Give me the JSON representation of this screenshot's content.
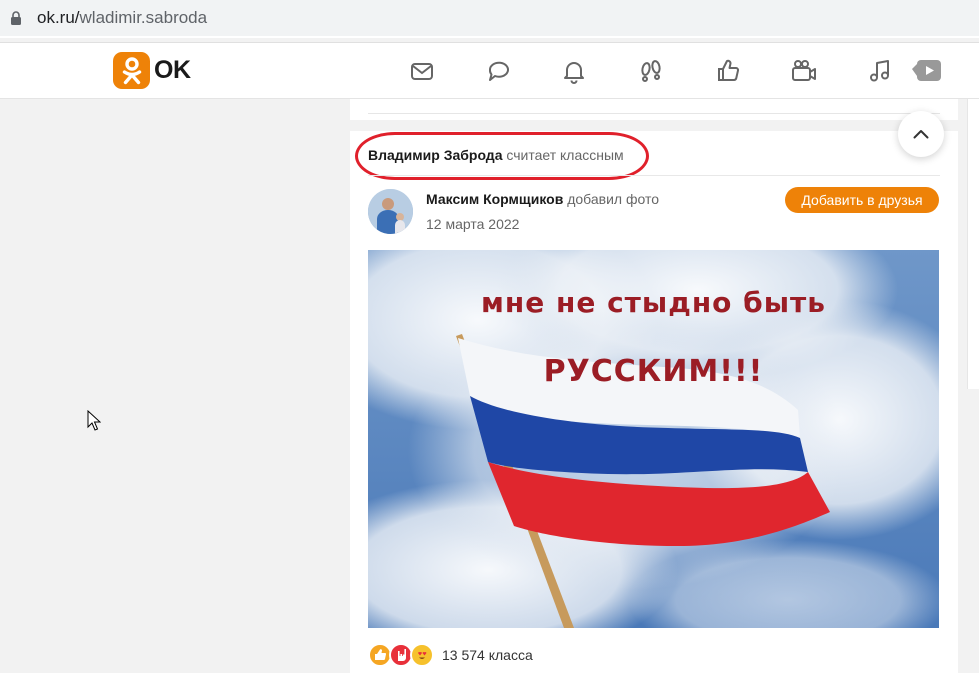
{
  "browser": {
    "url_host": "ok.ru/",
    "url_path": "wladimir.sabroda",
    "icon": "lock-icon"
  },
  "header": {
    "logo_text": "OK",
    "brand_color": "#ee8208",
    "nav_icons": [
      "messages-icon",
      "discussions-icon",
      "notifications-icon",
      "guests-icon",
      "events-like-icon",
      "video-icon",
      "music-icon",
      "video-play-icon"
    ]
  },
  "feed": {
    "activity": {
      "actor": "Владимир Заброда",
      "action": "считает классным"
    },
    "highlight_color": "#e0202b",
    "post": {
      "author": "Максим Кормщиков",
      "action": "добавил фото",
      "date": "12 марта 2022",
      "add_friend_label": "Добавить в друзья",
      "image_text_line1": "мне не стыдно быть",
      "image_text_line2": "РУССКИМ!!!",
      "reactions": [
        "like-icon",
        "rock-hand-icon",
        "heart-eyes-icon"
      ],
      "reactions_count": "13 574 класса"
    }
  },
  "scroll_top_icon": "chevron-up-icon"
}
